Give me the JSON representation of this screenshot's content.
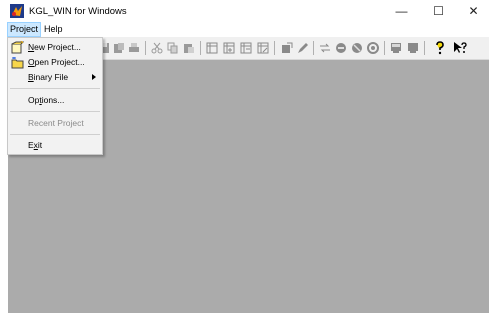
{
  "window": {
    "title": "KGL_WIN for Windows",
    "minimize_glyph": "—",
    "maximize_glyph": "☐",
    "close_glyph": "✕"
  },
  "menubar": {
    "items": [
      {
        "label": "Project"
      },
      {
        "label": "Help"
      }
    ]
  },
  "project_menu": {
    "items": [
      {
        "label": "New Project...",
        "mnemonic": "N",
        "rest": "ew Project...",
        "icon": "new-project-icon"
      },
      {
        "label": "Open Project...",
        "mnemonic": "O",
        "rest": "pen Project...",
        "icon": "open-project-icon"
      },
      {
        "label": "Binary File",
        "mnemonic": "B",
        "rest": "inary File",
        "submenu": true
      },
      {
        "label": "Options...",
        "pre": "Op",
        "mnemonic": "t",
        "rest": "ions..."
      },
      {
        "label": "Recent Project",
        "disabled": true
      },
      {
        "label": "Exit",
        "pre": "E",
        "mnemonic": "x",
        "rest": "it"
      }
    ]
  },
  "toolbar": {
    "icons": [
      "new-icon",
      "open-icon",
      "save-icon",
      "print-icon",
      "cut-icon",
      "copy-icon",
      "paste-icon",
      "frame-icon",
      "frame-add-icon",
      "frame-insert-icon",
      "frame-edit-icon",
      "compile-icon",
      "edit-pen-icon",
      "transfer-icon",
      "connect-icon",
      "disconnect-icon",
      "monitor-icon",
      "display-icon",
      "screen-icon",
      "help-icon",
      "context-help-icon"
    ]
  },
  "colors": {
    "workspace": "#ababab",
    "menu_highlight": "#cce8ff",
    "toolbar": "#f0f0f0"
  }
}
